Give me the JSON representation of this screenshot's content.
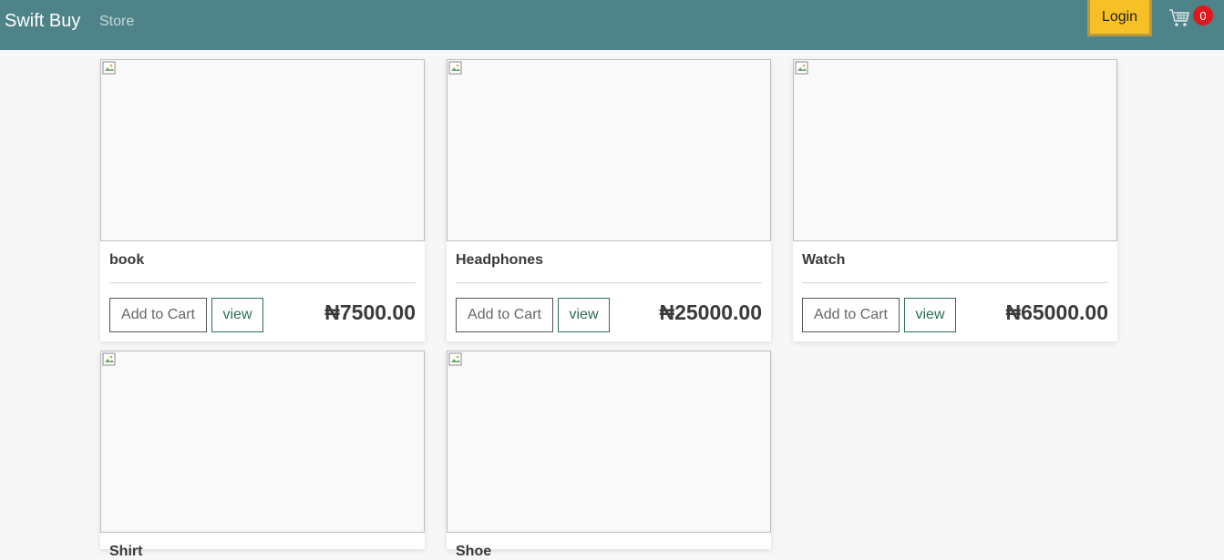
{
  "navbar": {
    "brand": "Swift Buy",
    "store_link": "Store",
    "login_label": "Login",
    "cart_count": "0"
  },
  "products": [
    {
      "name": "book",
      "price": "₦7500.00",
      "add_label": "Add to Cart",
      "view_label": "view"
    },
    {
      "name": "Headphones",
      "price": "₦25000.00",
      "add_label": "Add to Cart",
      "view_label": "view"
    },
    {
      "name": "Watch",
      "price": "₦65000.00",
      "add_label": "Add to Cart",
      "view_label": "view"
    },
    {
      "name": "Shirt",
      "price": "",
      "add_label": "",
      "view_label": ""
    },
    {
      "name": "Shoe",
      "price": "",
      "add_label": "",
      "view_label": ""
    }
  ],
  "colors": {
    "navbar_bg": "#4e8489",
    "login_bg": "#f6c026",
    "badge_bg": "#e0191c",
    "view_accent": "#2b6e53"
  },
  "icons": {
    "cart": "shopping-cart-icon",
    "image_placeholder": "broken-image-icon"
  }
}
